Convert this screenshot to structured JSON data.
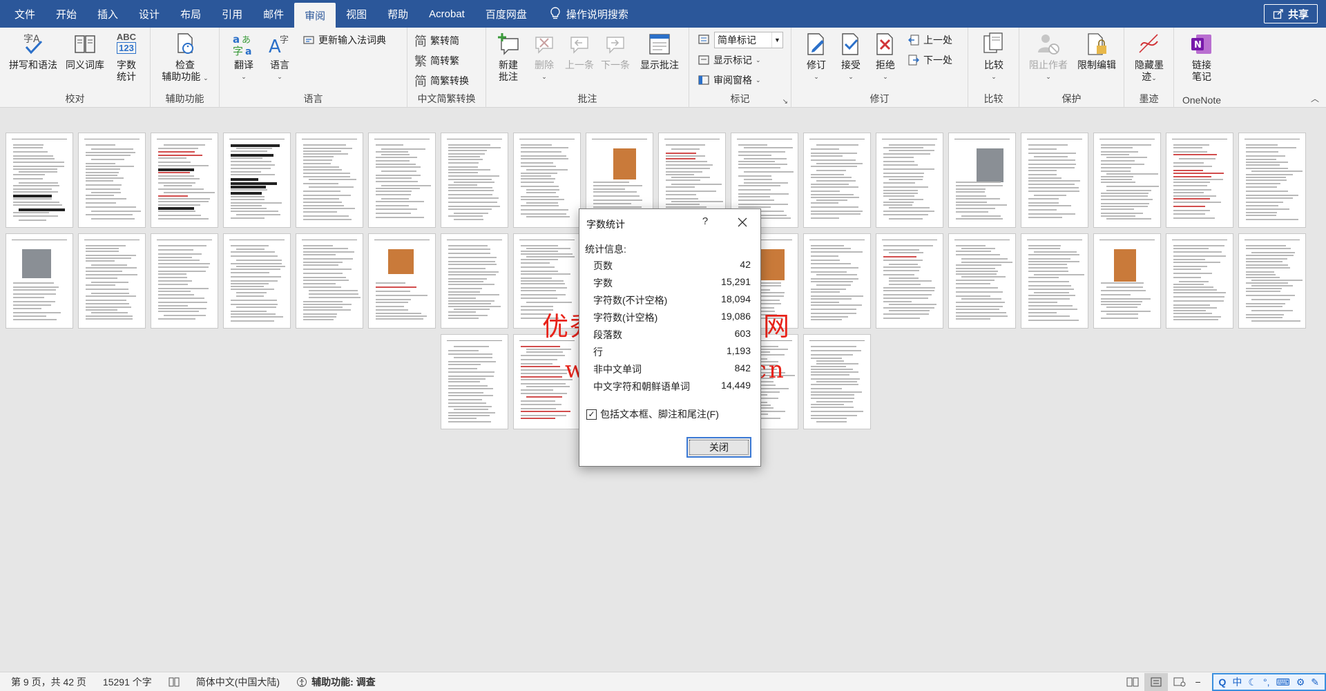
{
  "menubar": {
    "tabs": [
      "文件",
      "开始",
      "插入",
      "设计",
      "布局",
      "引用",
      "邮件",
      "审阅",
      "视图",
      "帮助",
      "Acrobat",
      "百度网盘"
    ],
    "active_tab": "审阅",
    "search_label": "操作说明搜索",
    "share_label": "共享"
  },
  "ribbon": {
    "proofing": {
      "label": "校对",
      "spelling": "拼写和语法",
      "thesaurus": "同义词库",
      "wordcount_l1": "字数",
      "wordcount_l2": "统计",
      "abc": "ABC",
      "num": "123"
    },
    "accessibility": {
      "label": "辅助功能",
      "check_l1": "检查",
      "check_l2": "辅助功能"
    },
    "language": {
      "label": "语言",
      "translate": "翻译",
      "language": "语言",
      "update_ime": "更新输入法词典"
    },
    "chinese_conv": {
      "label": "中文简繁转换",
      "to_simplified": "繁转简",
      "to_traditional": "简转繁",
      "conversion": "简繁转换",
      "g1": "简",
      "g2": "繁",
      "g3": "简"
    },
    "comments": {
      "label": "批注",
      "new_l1": "新建",
      "new_l2": "批注",
      "delete": "删除",
      "previous": "上一条",
      "next": "下一条",
      "show": "显示批注"
    },
    "tracking": {
      "label": "标记",
      "markup_select": "简单标记",
      "show_markup": "显示标记",
      "reviewing_pane": "审阅窗格"
    },
    "changes": {
      "label": "修订",
      "track": "修订",
      "accept": "接受",
      "reject": "拒绝",
      "previous": "上一处",
      "next": "下一处"
    },
    "compare": {
      "label": "比较",
      "compare": "比较"
    },
    "protect": {
      "label": "保护",
      "block_authors": "阻止作者",
      "restrict": "限制编辑"
    },
    "ink": {
      "label": "墨迹",
      "hide_l1": "隐藏墨",
      "hide_l2": "迹"
    },
    "onenote": {
      "label": "OneNote",
      "link_l1": "链接",
      "link_l2": "笔记"
    }
  },
  "dialog": {
    "title": "字数统计",
    "help": "?",
    "section": "统计信息:",
    "stats": [
      {
        "label": "页数",
        "value": "42"
      },
      {
        "label": "字数",
        "value": "15,291"
      },
      {
        "label": "字符数(不计空格)",
        "value": "18,094"
      },
      {
        "label": "字符数(计空格)",
        "value": "19,086"
      },
      {
        "label": "段落数",
        "value": "603"
      },
      {
        "label": "行",
        "value": "1,193"
      },
      {
        "label": "非中文单词",
        "value": "842"
      },
      {
        "label": "中文字符和朝鲜语单词",
        "value": "14,449"
      }
    ],
    "checkbox_label": "包括文本框、脚注和尾注(F)",
    "checkbox_checked": true,
    "close_button": "关闭"
  },
  "watermark": {
    "line1": "优秀毕业设计资源网",
    "line2": "www.keyicad.cn"
  },
  "statusbar": {
    "page": "第 9 页，共 42 页",
    "words": "15291 个字",
    "language": "简体中文(中国大陆)",
    "accessibility": "辅助功能: 调查",
    "ime_mode": "中"
  },
  "colors": {
    "ribbon_blue": "#2b579a",
    "watermark_red": "#e8231a",
    "dialog_button_border": "#3c7ad5"
  }
}
